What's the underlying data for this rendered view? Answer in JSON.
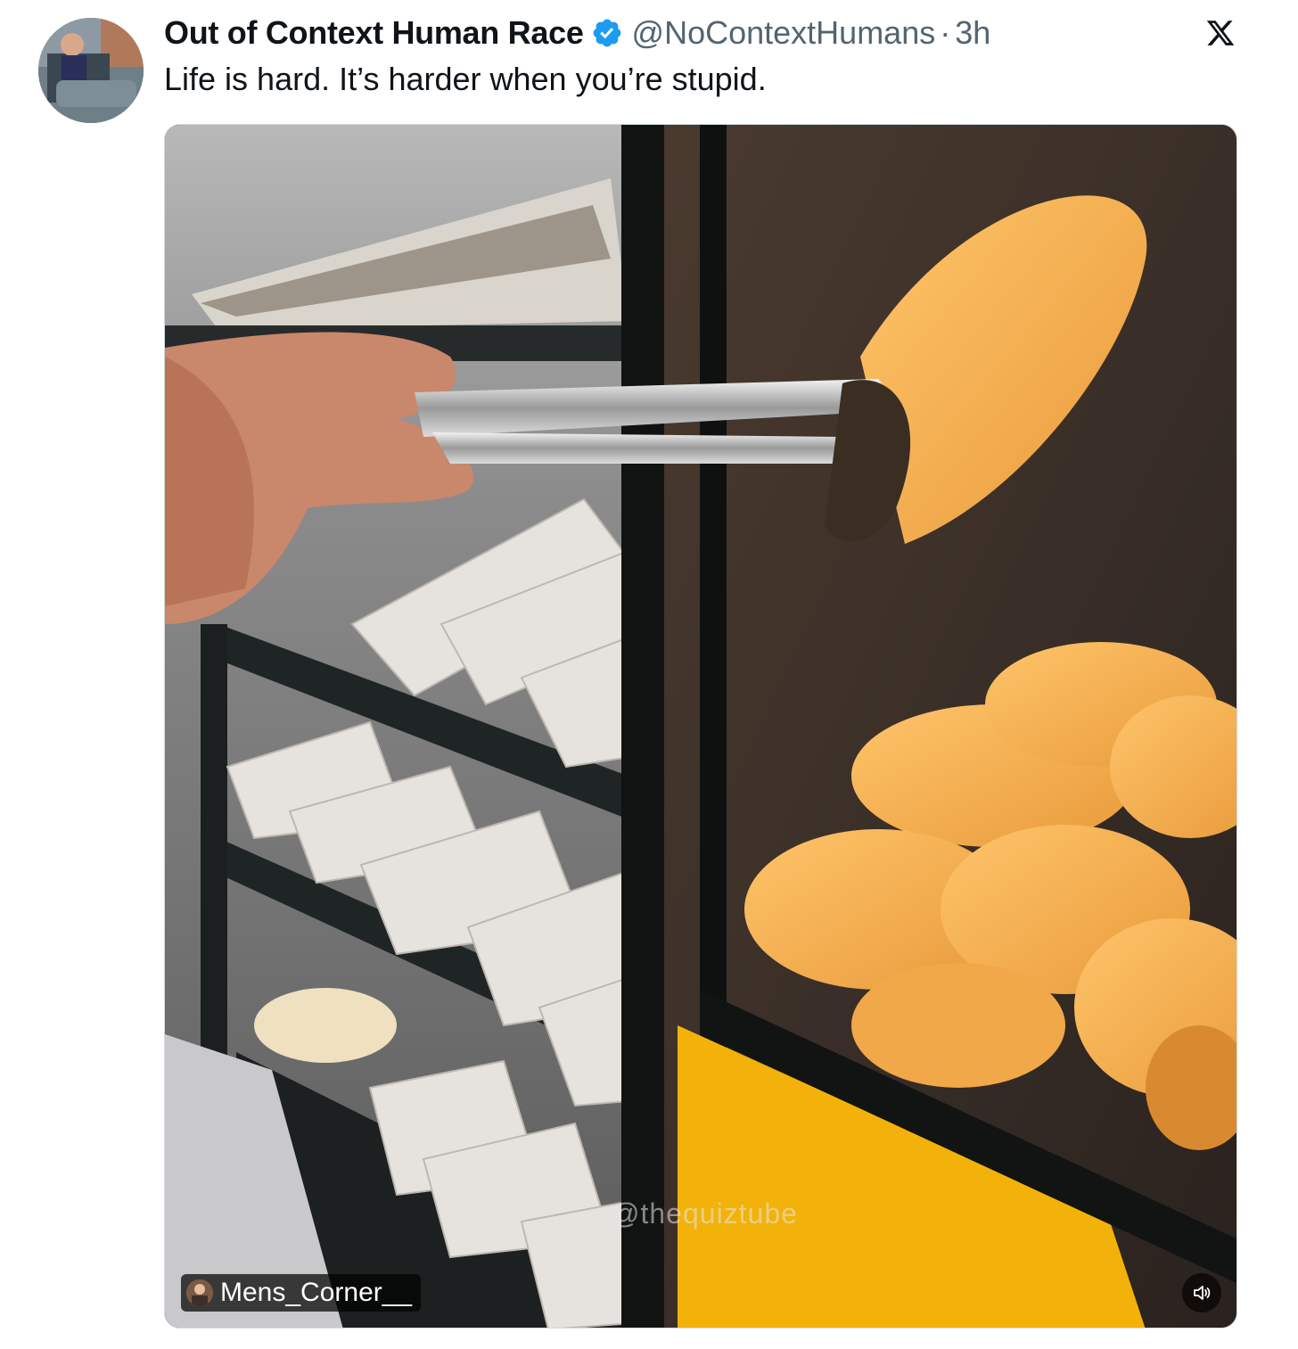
{
  "tweet": {
    "display_name": "Out of Context Human Race",
    "handle": "@NoContextHumans",
    "separator": "·",
    "time": "3h",
    "text": "Life is hard. It’s harder when you’re stupid.",
    "verified": true
  },
  "media": {
    "credit_label": "Mens_Corner__",
    "watermark": "@thequiztube",
    "type": "video"
  },
  "icons": {
    "verified": "verified-badge-icon",
    "close": "x-logo-icon",
    "volume": "volume-icon"
  },
  "colors": {
    "text_primary": "#0f1419",
    "text_secondary": "#536471",
    "verified_blue": "#1d9bf0"
  }
}
